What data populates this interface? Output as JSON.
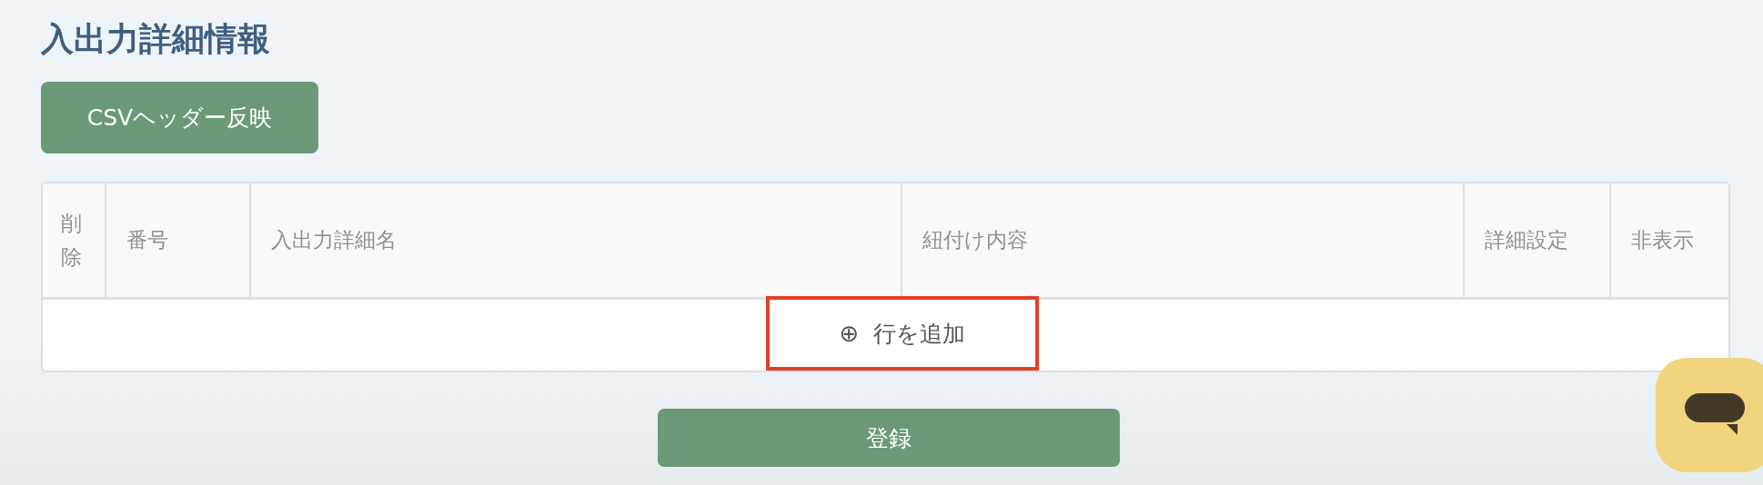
{
  "section_title": "入出力詳細情報",
  "csv_button": {
    "label": "CSVヘッダー反映"
  },
  "table": {
    "columns": [
      "削除",
      "番号",
      "入出力詳細名",
      "紐付け内容",
      "詳細設定",
      "非表示"
    ],
    "add_row_button": {
      "icon": "⊕",
      "label": "行を追加"
    }
  },
  "submit_button": {
    "label": "登録"
  }
}
